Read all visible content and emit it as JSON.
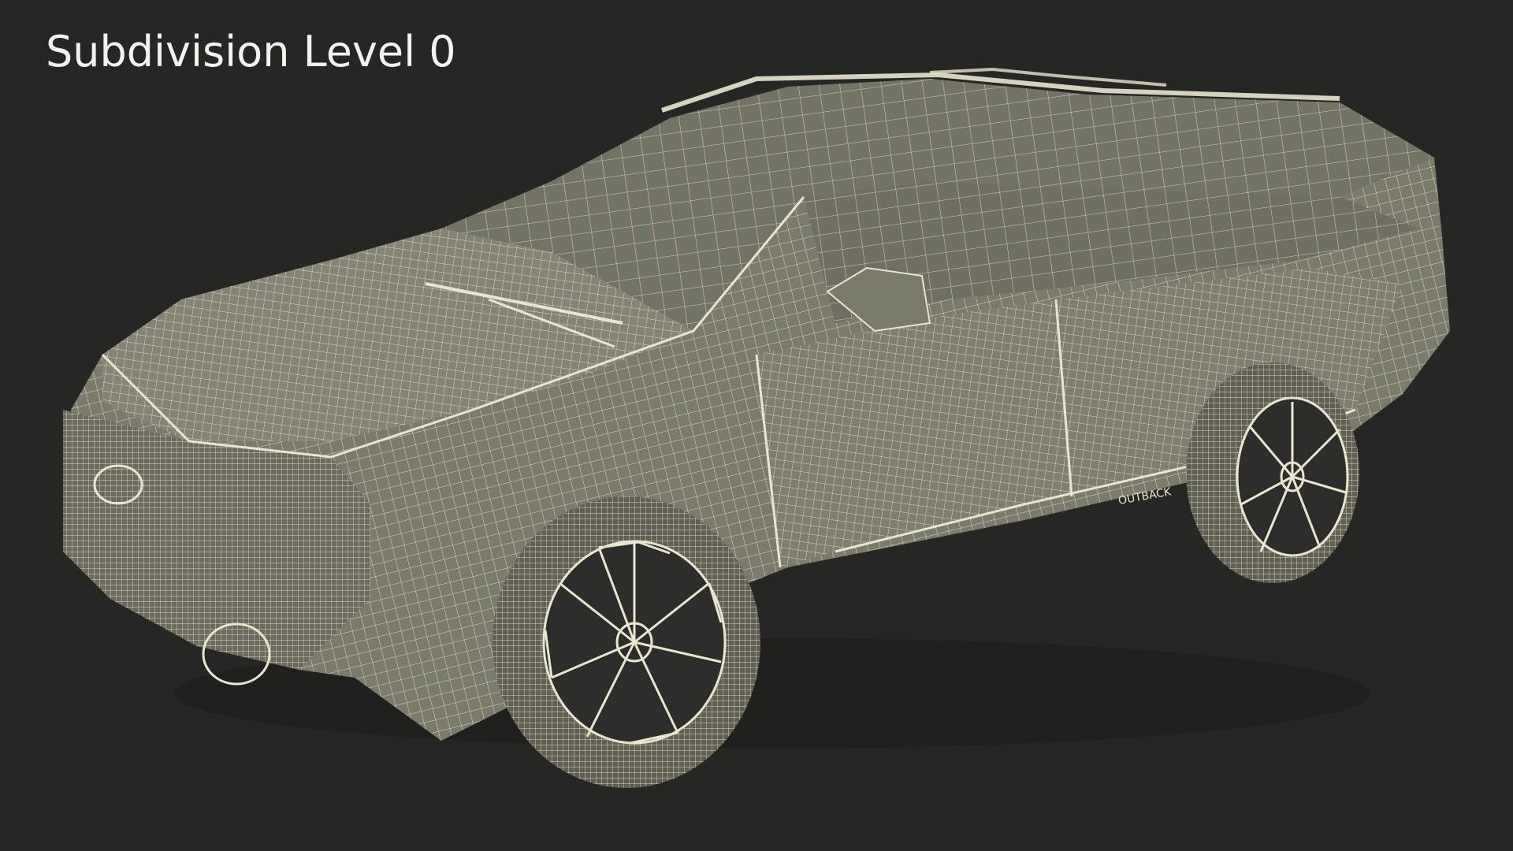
{
  "caption": {
    "text": "Subdivision Level 0"
  },
  "render": {
    "subject": "wireframe-car-model",
    "badge_text": "OUTBACK",
    "colors": {
      "background": "#262725",
      "body_fill": "#7b7b6c",
      "body_shade": "#67675a",
      "wire": "#e9e6cf",
      "caption_text": "#f2f2ef"
    }
  }
}
